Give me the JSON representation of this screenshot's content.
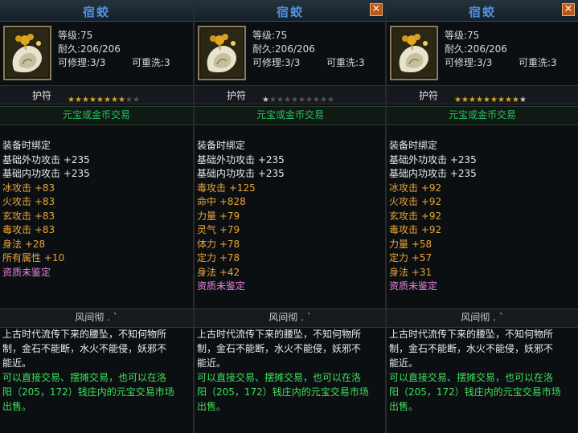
{
  "common": {
    "item_name": "宿蛟",
    "item_type": "护符",
    "trade_note": "元宝或金币交易",
    "level_label": "等级:",
    "level_value": "75",
    "durability_label": "耐久:",
    "durability_value": "206/206",
    "repair_label": "可修理:",
    "repair_value": "3/3",
    "rewash_label": "可重洗:",
    "rewash_value": "3",
    "bind_text": "装备时绑定",
    "footer_text": "风间彻 . `",
    "desc_line1": "上古时代流传下来的腰坠，不知何物所",
    "desc_line2": "制，金石不能断，水火不能侵，妖邪不",
    "desc_line3": "能近。",
    "desc_line4": "可以直接交易、摆摊交易，也可以在洛",
    "desc_line5": "阳（205，172）钱庄内的元宝交易市场",
    "desc_line6": "出售。",
    "unidentified": "资质未鉴定",
    "close_glyph": "✕"
  },
  "panels": [
    {
      "show_close": false,
      "stars": {
        "total": 10,
        "on": 8,
        "half": 0
      },
      "attributes": [
        {
          "text": "基础外功攻击 +235",
          "color": "white"
        },
        {
          "text": "基础内功攻击 +235",
          "color": "white"
        },
        {
          "text": "冰攻击 +83",
          "color": "orange"
        },
        {
          "text": "火攻击 +83",
          "color": "orange"
        },
        {
          "text": "玄攻击 +83",
          "color": "orange"
        },
        {
          "text": "毒攻击 +83",
          "color": "orange"
        },
        {
          "text": "身法 +28",
          "color": "orange"
        },
        {
          "text": "所有属性 +10",
          "color": "orange"
        }
      ]
    },
    {
      "show_close": true,
      "stars": {
        "total": 10,
        "on": 0,
        "half": 1
      },
      "attributes": [
        {
          "text": "基础外功攻击 +235",
          "color": "white"
        },
        {
          "text": "基础内功攻击 +235",
          "color": "white"
        },
        {
          "text": "毒攻击 +125",
          "color": "orange"
        },
        {
          "text": "命中 +828",
          "color": "orange"
        },
        {
          "text": "力量 +79",
          "color": "orange"
        },
        {
          "text": "灵气 +79",
          "color": "orange"
        },
        {
          "text": "体力 +78",
          "color": "orange"
        },
        {
          "text": "定力 +78",
          "color": "orange"
        },
        {
          "text": "身法 +42",
          "color": "orange"
        }
      ]
    },
    {
      "show_close": true,
      "stars": {
        "total": 10,
        "on": 9,
        "half": 1
      },
      "attributes": [
        {
          "text": "基础外功攻击 +235",
          "color": "white"
        },
        {
          "text": "基础内功攻击 +235",
          "color": "white"
        },
        {
          "text": "冰攻击 +92",
          "color": "orange"
        },
        {
          "text": "火攻击 +92",
          "color": "orange"
        },
        {
          "text": "玄攻击 +92",
          "color": "orange"
        },
        {
          "text": "毒攻击 +92",
          "color": "orange"
        },
        {
          "text": "力量 +58",
          "color": "orange"
        },
        {
          "text": "定力 +57",
          "color": "orange"
        },
        {
          "text": "身法 +31",
          "color": "orange"
        }
      ]
    }
  ],
  "colors": {
    "title": "#4e8fe3",
    "trade": "#22c35e",
    "attr_orange": "#e9a53a",
    "unidentified": "#e783e0",
    "desc_green": "#3ee05a"
  }
}
